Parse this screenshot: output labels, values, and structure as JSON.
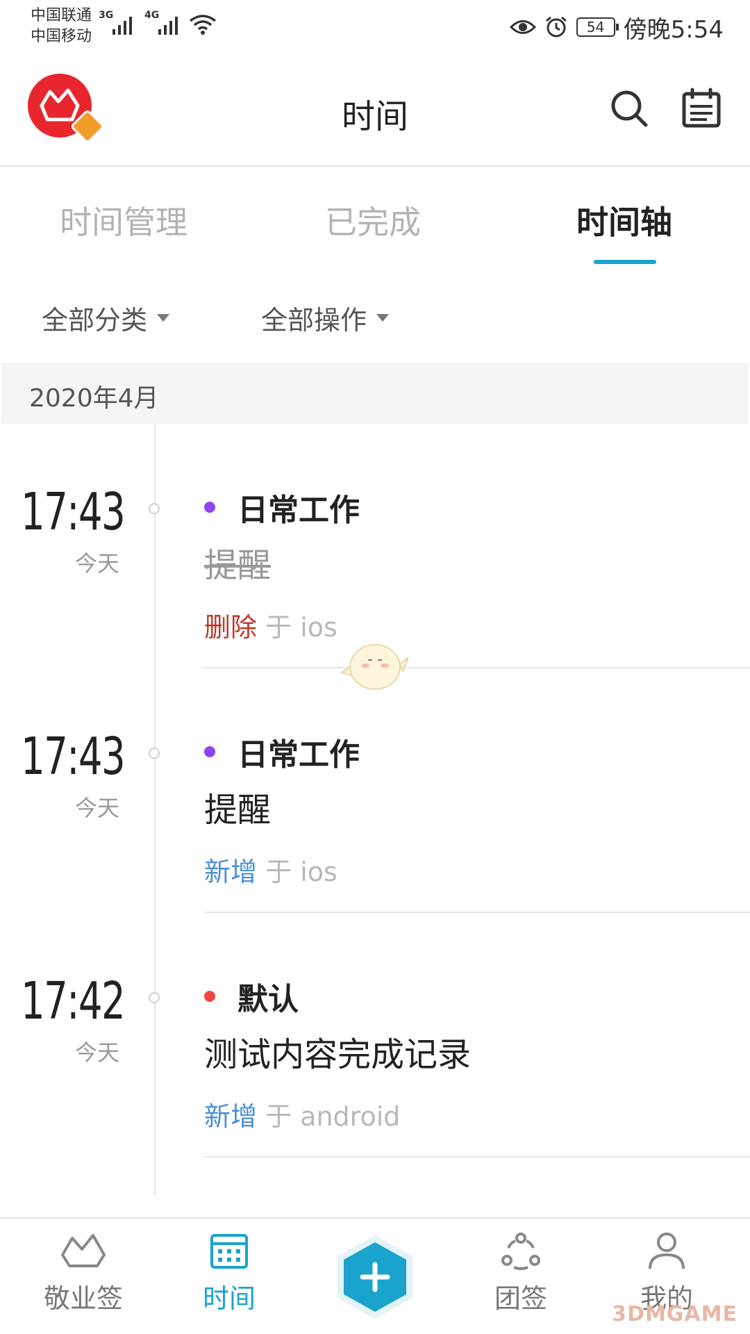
{
  "status_bar": {
    "carrier_1": "中国联通",
    "carrier_2": "中国移动",
    "network_1": "3G",
    "network_2": "4G",
    "battery": "54",
    "time": "傍晚5:54"
  },
  "header": {
    "title": "时间",
    "icons": [
      "app-logo",
      "search-icon",
      "calendar-icon"
    ]
  },
  "tabs": [
    {
      "label": "时间管理",
      "active": false
    },
    {
      "label": "已完成",
      "active": false
    },
    {
      "label": "时间轴",
      "active": true
    }
  ],
  "filters": {
    "category": "全部分类",
    "action": "全部操作"
  },
  "month_label": "2020年4月",
  "entries": [
    {
      "time": "17:43",
      "day": "今天",
      "category": "日常工作",
      "category_color": "#8e44f0",
      "content": "提醒",
      "struck": true,
      "action": "删除",
      "action_color": "#c0392b",
      "via": "于 ios"
    },
    {
      "time": "17:43",
      "day": "今天",
      "category": "日常工作",
      "category_color": "#8e44f0",
      "content": "提醒",
      "struck": false,
      "action": "新增",
      "action_color": "#4a8fd6",
      "via": "于 ios"
    },
    {
      "time": "17:42",
      "day": "今天",
      "category": "默认",
      "category_color": "#f0473f",
      "content": "测试内容完成记录",
      "struck": false,
      "action": "新增",
      "action_color": "#4a8fd6",
      "via": "于 android"
    }
  ],
  "bottom_nav": {
    "items": [
      {
        "label": "敬业签",
        "icon": "boat-icon",
        "active": false
      },
      {
        "label": "时间",
        "icon": "calendar-icon",
        "active": true
      },
      {
        "label": "团签",
        "icon": "group-icon",
        "active": false
      },
      {
        "label": "我的",
        "icon": "person-icon",
        "active": false
      }
    ],
    "fab_icon": "plus-icon"
  },
  "watermark": "3DMGAME",
  "colors": {
    "accent": "#1aa3cc",
    "logo_red": "#e8262e",
    "badge_orange": "#f39c2c"
  }
}
